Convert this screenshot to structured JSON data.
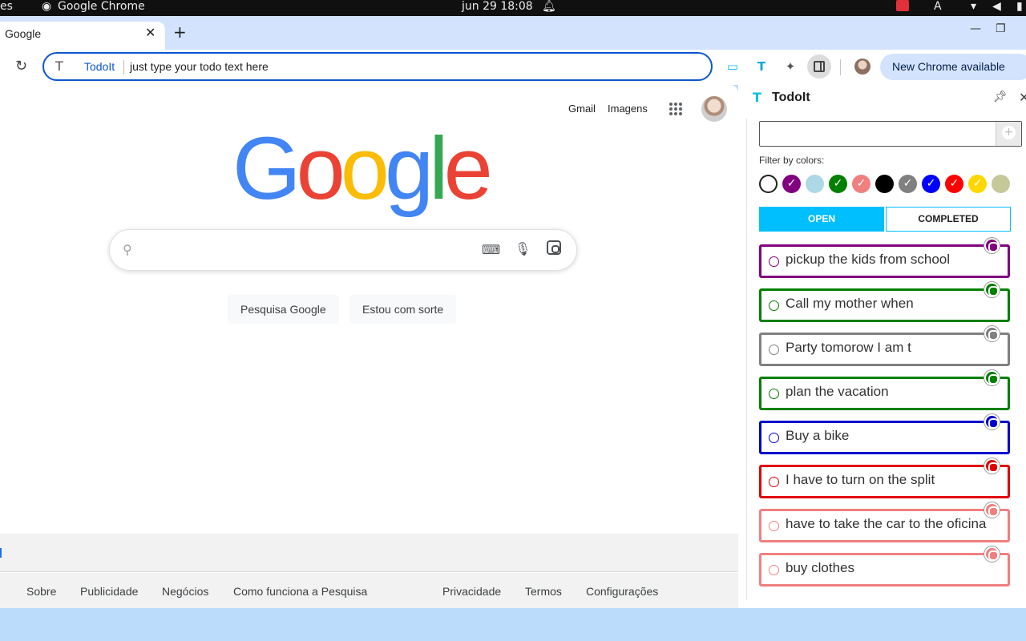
{
  "os_bar": {
    "left_text": "es",
    "app_name": "Google Chrome",
    "clock": "jun 29  18:08",
    "keyboard_layout": "A"
  },
  "browser": {
    "tab_title": "Google",
    "tab_close": "✕",
    "new_tab": "+",
    "omnibox_keyword": "TodoIt",
    "omnibox_text": "just type your todo text here",
    "update_button": "New Chrome available"
  },
  "google": {
    "header_links": [
      "Gmail",
      "Imagens"
    ],
    "logo_letters": [
      "G",
      "o",
      "o",
      "g",
      "l",
      "e"
    ],
    "buttons": [
      "Pesquisa Google",
      "Estou com sorte"
    ],
    "footer_links": [
      "Sobre",
      "Publicidade",
      "Negócios",
      "Como funciona a Pesquisa",
      "Privacidade",
      "Termos",
      "Configurações"
    ]
  },
  "side_panel": {
    "title": "TodoIt",
    "filter_label": "Filter by colors:",
    "colors": [
      {
        "name": "none",
        "hex": "#ffffff",
        "border": "#1f1f1f",
        "checked": false
      },
      {
        "name": "purple",
        "hex": "#800080",
        "checked": true
      },
      {
        "name": "lightblue",
        "hex": "#add8e6",
        "checked": false
      },
      {
        "name": "green",
        "hex": "#008000",
        "checked": true
      },
      {
        "name": "lightcoral",
        "hex": "#f08080",
        "checked": true
      },
      {
        "name": "black",
        "hex": "#000000",
        "checked": false
      },
      {
        "name": "gray",
        "hex": "#808080",
        "checked": true
      },
      {
        "name": "blue",
        "hex": "#0000ff",
        "checked": true
      },
      {
        "name": "red",
        "hex": "#ff0000",
        "checked": true
      },
      {
        "name": "gold",
        "hex": "#ffd700",
        "checked": true
      },
      {
        "name": "khaki",
        "hex": "#c5c99a",
        "checked": false
      }
    ],
    "tabs": {
      "open": "OPEN",
      "completed": "COMPLETED"
    },
    "todos": [
      {
        "text": "pickup the kids from school",
        "color": "#800080"
      },
      {
        "text": "Call my mother when",
        "color": "#008000"
      },
      {
        "text": "Party tomorow I am t",
        "color": "#808080"
      },
      {
        "text": "plan the vacation",
        "color": "#008000"
      },
      {
        "text": "Buy a bike",
        "color": "#0000cd"
      },
      {
        "text": "I have to turn on the split",
        "color": "#e00000"
      },
      {
        "text": "have to take the car to the oficina",
        "color": "#f08080"
      },
      {
        "text": "buy clothes",
        "color": "#f08080"
      }
    ]
  }
}
